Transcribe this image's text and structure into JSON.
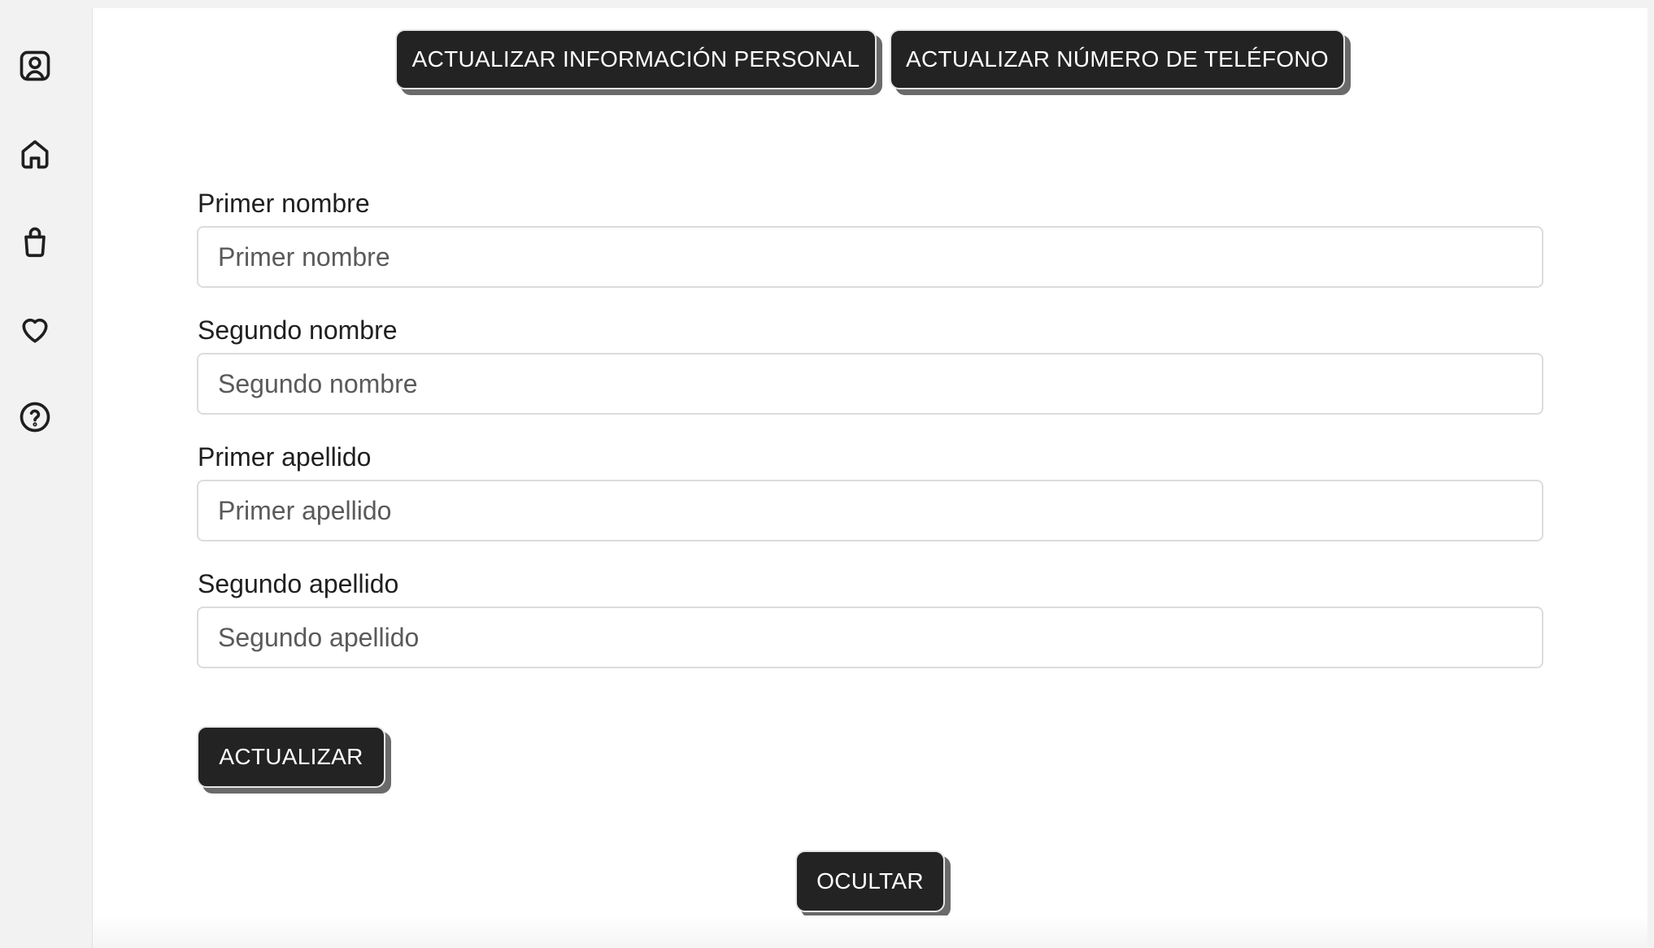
{
  "sidebar": {
    "items": [
      {
        "icon": "user-icon"
      },
      {
        "icon": "home-icon"
      },
      {
        "icon": "shopping-bag-icon"
      },
      {
        "icon": "heart-icon"
      },
      {
        "icon": "help-icon"
      }
    ]
  },
  "tabs": {
    "personal_info_label": "ACTUALIZAR INFORMACIÓN PERSONAL",
    "phone_number_label": "ACTUALIZAR NÚMERO DE TELÉFONO"
  },
  "form": {
    "first_name": {
      "label": "Primer nombre",
      "placeholder": "Primer nombre",
      "value": ""
    },
    "middle_name": {
      "label": "Segundo nombre",
      "placeholder": "Segundo nombre",
      "value": ""
    },
    "first_surname": {
      "label": "Primer apellido",
      "placeholder": "Primer apellido",
      "value": ""
    },
    "second_surname": {
      "label": "Segundo apellido",
      "placeholder": "Segundo apellido",
      "value": ""
    },
    "submit_label": "ACTUALIZAR"
  },
  "hide_label": "OCULTAR",
  "colors": {
    "button_bg": "#232323",
    "button_text": "#ffffff",
    "button_shadow": "#6a6a6a",
    "sidebar_bg": "#f2f2f2",
    "panel_bg": "#ffffff"
  }
}
